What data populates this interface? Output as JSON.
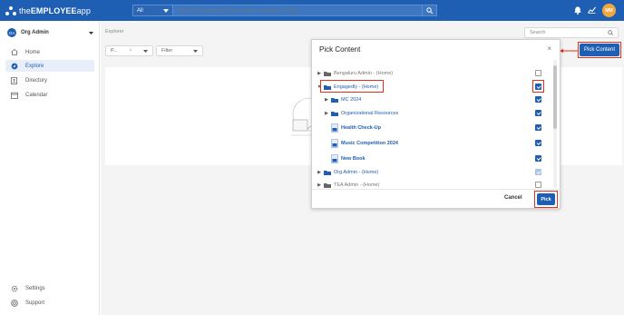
{
  "app": {
    "logo_prefix": "the",
    "logo_main": "EMPLOYEE",
    "logo_suffix": "app"
  },
  "topbar": {
    "scope_selected": "All",
    "search_placeholder": "Search for contents, folders, events, contacts or #Tags",
    "avatar_initials": "MM"
  },
  "sidebar": {
    "org_initials": "OA",
    "org_name": "Org Admin",
    "items": [
      {
        "label": "Home"
      },
      {
        "label": "Explore"
      },
      {
        "label": "Directory"
      },
      {
        "label": "Calendar"
      }
    ],
    "bottom": [
      {
        "label": "Settings"
      },
      {
        "label": "Support"
      }
    ]
  },
  "main": {
    "breadcrumb": "Explorer",
    "chip1": "P...",
    "filter": "Filter",
    "search_placeholder": "Search",
    "pick_content_button": "Pick Content"
  },
  "modal": {
    "title": "Pick Content",
    "close": "×",
    "rows": [
      {
        "label": "Bengaluru Admin - (Home)",
        "kind": "folder",
        "checked": false
      },
      {
        "label": "Engagedly - (Home)",
        "kind": "folder",
        "checked": true
      },
      {
        "label": "MC 2024",
        "kind": "folder",
        "checked": true
      },
      {
        "label": "Organizational Resources",
        "kind": "folder",
        "checked": true
      },
      {
        "label": "Health Check-Up",
        "kind": "doc",
        "checked": true
      },
      {
        "label": "Music Competition 2024",
        "kind": "doc",
        "checked": true
      },
      {
        "label": "New Book",
        "kind": "doc",
        "checked": true
      },
      {
        "label": "Org Admin - (Home)",
        "kind": "folder",
        "checked": true
      },
      {
        "label": "TEA Admin - (Home)",
        "kind": "folder",
        "checked": false
      }
    ],
    "cancel_label": "Cancel",
    "pick_label": "Pick"
  },
  "colors": {
    "brand": "#1f5fb3",
    "highlight": "#e0301e",
    "avatar": "#f4a73a"
  }
}
